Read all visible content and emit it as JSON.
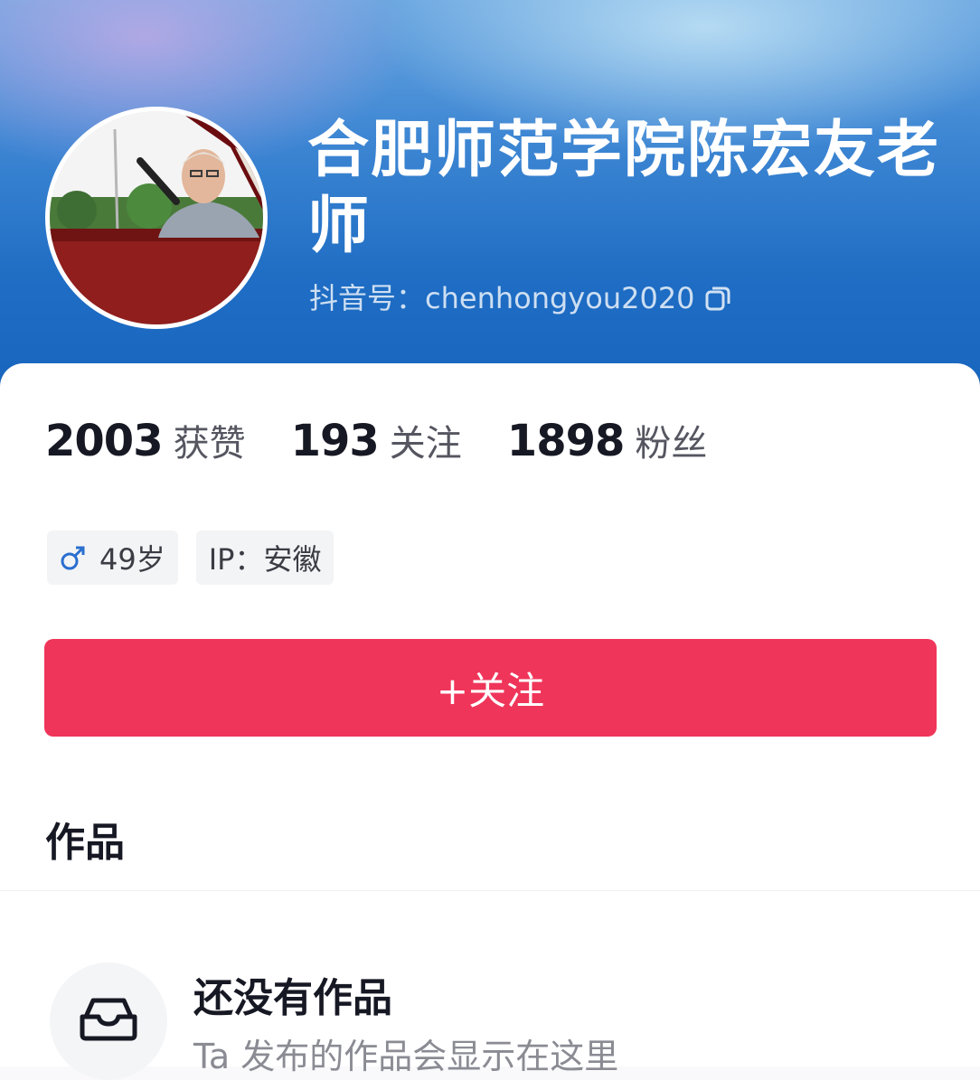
{
  "profile": {
    "name": "合肥师范学院陈宏友老师",
    "douyin_id": "抖音号：chenhongyou2020",
    "avatar_icon": "profile-photo"
  },
  "stats": [
    {
      "value": "2003",
      "label": "获赞"
    },
    {
      "value": "193",
      "label": "关注"
    },
    {
      "value": "1898",
      "label": "粉丝"
    }
  ],
  "tags": {
    "gender_icon": "male-icon",
    "age": "49岁",
    "ip": "IP：安徽"
  },
  "follow_button": {
    "label": "+关注",
    "color": "#f0355a"
  },
  "works": {
    "heading": "作品",
    "empty_icon": "inbox-icon",
    "empty_title": "还没有作品",
    "empty_subtitle": "Ta 发布的作品会显示在这里"
  }
}
